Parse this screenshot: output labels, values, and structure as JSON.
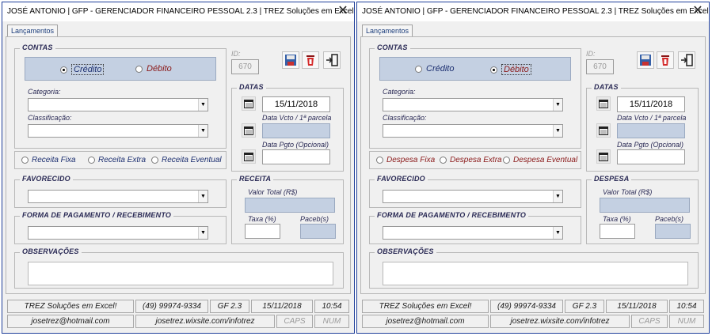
{
  "panels": [
    {
      "title": "JOSÉ ANTONIO    |   GFP - GERENCIADOR FINANCEIRO PESSOAL 2.3    |   TREZ Soluções em Excel",
      "close_icon": "close-icon",
      "tab_label": "Lançamentos",
      "contas": {
        "title": "CONTAS",
        "credito": "Crédito",
        "debito": "Débito",
        "selected": "credito"
      },
      "id_label": "ID:",
      "id_value": "670",
      "categoria_label": "Categoria:",
      "classificacao_label": "Classificação:",
      "tipos": [
        "Receita Fixa",
        "Receita Extra",
        "Receita Eventual"
      ],
      "datas": {
        "title": "DATAS",
        "date_value": "15/11/2018",
        "vcto_label": "Data Vcto / 1ª parcela",
        "pgto_label": "Data Pgto (Opcional)"
      },
      "favorecido": "FAVORECIDO",
      "forma": "FORMA DE PAGAMENTO / RECEBIMENTO",
      "tipo_frame": {
        "title": "RECEITA",
        "valor_label": "Valor Total (R$)",
        "taxa_label": "Taxa (%)",
        "parcelas_label": "Paceb(s)"
      },
      "observacoes": "OBSERVAÇÕES",
      "status": {
        "company": "TREZ Soluções em Excel!",
        "phone": "(49) 99974-9334",
        "version": "GF 2.3",
        "date": "15/11/2018",
        "time": "10:54",
        "email": "josetrez@hotmail.com",
        "site": "josetrez.wixsite.com/infotrez",
        "caps": "CAPS",
        "num": "NUM"
      }
    },
    {
      "title": "JOSÉ ANTONIO    |   GFP - GERENCIADOR FINANCEIRO PESSOAL 2.3    |   TREZ Soluções em Excel",
      "close_icon": "close-icon",
      "tab_label": "Lançamentos",
      "contas": {
        "title": "CONTAS",
        "credito": "Crédito",
        "debito": "Débito",
        "selected": "debito"
      },
      "id_label": "ID:",
      "id_value": "670",
      "categoria_label": "Categoria:",
      "classificacao_label": "Classificação:",
      "tipos": [
        "Despesa Fixa",
        "Despesa Extra",
        "Despesa Eventual"
      ],
      "datas": {
        "title": "DATAS",
        "date_value": "15/11/2018",
        "vcto_label": "Data Vcto / 1ª parcela",
        "pgto_label": "Data Pgto (Opcional)"
      },
      "favorecido": "FAVORECIDO",
      "forma": "FORMA DE PAGAMENTO / RECEBIMENTO",
      "tipo_frame": {
        "title": "DESPESA",
        "valor_label": "Valor Total (R$)",
        "taxa_label": "Taxa (%)",
        "parcelas_label": "Paceb(s)"
      },
      "observacoes": "OBSERVAÇÕES",
      "status": {
        "company": "TREZ Soluções em Excel!",
        "phone": "(49) 99974-9334",
        "version": "GF 2.3",
        "date": "15/11/2018",
        "time": "10:54",
        "email": "josetrez@hotmail.com",
        "site": "josetrez.wixsite.com/infotrez",
        "caps": "CAPS",
        "num": "NUM"
      }
    }
  ],
  "colors": {
    "window_border": "#1f3f9a",
    "radio_bar": "#c4d0e2",
    "accent_red": "#8b1a1a",
    "accent_navy": "#1c2f70"
  }
}
